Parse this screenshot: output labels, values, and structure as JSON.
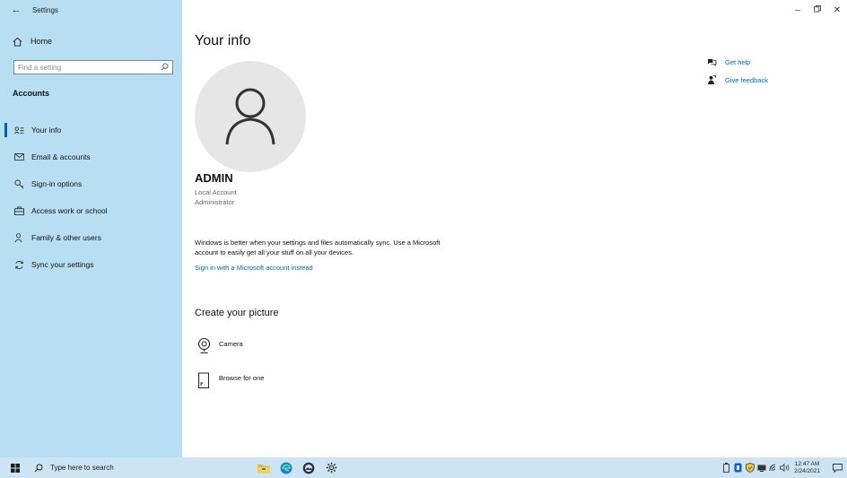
{
  "window": {
    "title": "Settings"
  },
  "sidebar": {
    "home_label": "Home",
    "search_placeholder": "Find a setting",
    "section_title": "Accounts",
    "items": [
      {
        "label": "Your info",
        "icon": "person-card-icon",
        "active": true
      },
      {
        "label": "Email & accounts",
        "icon": "mail-icon"
      },
      {
        "label": "Sign-in options",
        "icon": "key-icon"
      },
      {
        "label": "Access work or school",
        "icon": "briefcase-icon"
      },
      {
        "label": "Family & other users",
        "icon": "people-icon"
      },
      {
        "label": "Sync your settings",
        "icon": "sync-icon"
      }
    ]
  },
  "main": {
    "title": "Your info",
    "user": {
      "name": "ADMIN",
      "type": "Local Account",
      "role": "Administrator"
    },
    "sync_text": "Windows is better when your settings and files automatically sync. Use a Microsoft account to easily get all your stuff on all your devices.",
    "ms_link": "Sign in with a Microsoft account instead",
    "create_picture": {
      "title": "Create your picture",
      "options": [
        {
          "label": "Camera",
          "icon": "camera-icon"
        },
        {
          "label": "Browse for one",
          "icon": "file-icon"
        }
      ]
    },
    "help": {
      "get_help": "Get help",
      "give_feedback": "Give feedback"
    }
  },
  "taskbar": {
    "search_placeholder": "Type here to search",
    "time": "12:47 AM",
    "date": "2/24/2021"
  },
  "colors": {
    "sidebar_bg": "#b8def3",
    "accent": "#0063b1",
    "link": "#0067b8",
    "taskbar_bg": "#cde4f5"
  }
}
